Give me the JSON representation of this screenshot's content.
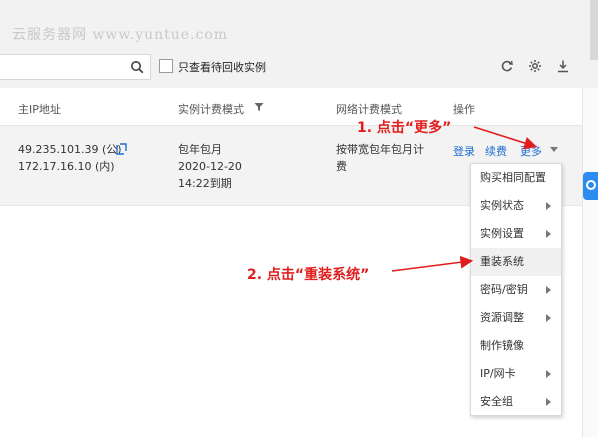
{
  "watermark": "云服务器网 www.yuntue.com",
  "search": {
    "placeholder": ""
  },
  "filter": {
    "checkbox_label": "只查看待回收实例"
  },
  "toolbar": {
    "icons": [
      "refresh-icon",
      "settings-icon",
      "download-icon"
    ]
  },
  "table": {
    "headers": {
      "main_ip": "主IP地址",
      "billing_mode": "实例计费模式",
      "network_billing": "网络计费模式",
      "actions": "操作"
    },
    "row": {
      "public_ip": "49.235.101.39 (公)",
      "private_ip": "172.17.16.10 (内)",
      "billing_line1": "包年包月",
      "billing_line2": "2020-12-20",
      "billing_line3": "14:22到期",
      "network_line1": "按带宽包年包月计",
      "network_line2": "费",
      "action_login": "登录",
      "action_renew": "续费",
      "action_more": "更多"
    }
  },
  "more_menu": {
    "items": [
      {
        "label": "购买相同配置",
        "submenu": false
      },
      {
        "label": "实例状态",
        "submenu": true
      },
      {
        "label": "实例设置",
        "submenu": true
      },
      {
        "label": "重装系统",
        "submenu": false,
        "highlighted": true
      },
      {
        "label": "密码/密钥",
        "submenu": true
      },
      {
        "label": "资源调整",
        "submenu": true
      },
      {
        "label": "制作镜像",
        "submenu": false
      },
      {
        "label": "IP/网卡",
        "submenu": true
      },
      {
        "label": "安全组",
        "submenu": true
      }
    ]
  },
  "annotations": {
    "step1": "1. 点击“更多”",
    "step2": "2. 点击“重装系统”"
  },
  "colors": {
    "link": "#1f6fd1",
    "annotation": "#e01e1e",
    "badge": "#2d8cf0"
  }
}
